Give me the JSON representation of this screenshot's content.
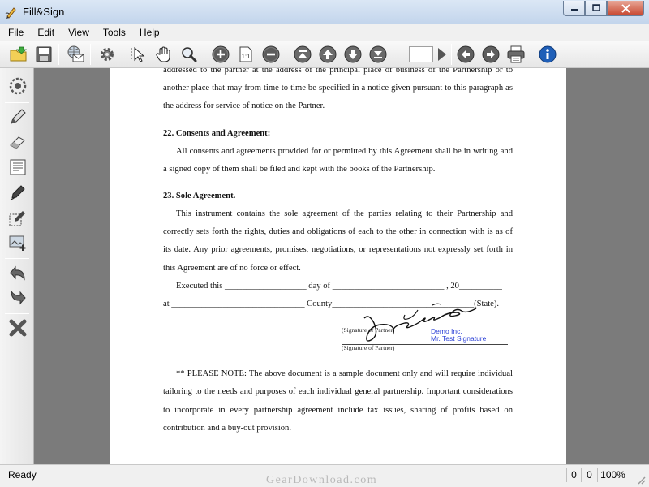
{
  "window": {
    "title": "Fill&Sign"
  },
  "menu": [
    {
      "key": "F",
      "rest": "ile"
    },
    {
      "key": "E",
      "rest": "dit"
    },
    {
      "key": "V",
      "rest": "iew"
    },
    {
      "key": "T",
      "rest": "ools"
    },
    {
      "key": "H",
      "rest": "elp"
    }
  ],
  "toolbar": {
    "page_number": ""
  },
  "document": {
    "p_intro": "addressed to the partner at the address of the principal place of business of the Partnership or to another place that may from time to time be specified in a notice given pursuant to this paragraph as the address for service of notice on the Partner.",
    "h22": "22. Consents and Agreement:",
    "p22": "All consents and agreements provided for or permitted by this Agreement shall be in writing and a signed copy of them shall be filed and kept with the books of the Partnership.",
    "h23": "23. Sole Agreement.",
    "p23": "This instrument contains the sole agreement of the parties relating to their Partnership and correctly sets forth the rights, duties and obligations of each to the other in connection with is as of its date. Any prior agreements, promises, negotiations, or representations not expressly set forth in this Agreement are of no force or effect.",
    "executed_line": "Executed this ___________________ day of __________________________ , 20__________",
    "county_line": "at _______________________________ County_________________________________(State).",
    "sig_label_1": "(Signature of Partner)",
    "sig_label_2": "(Signature of Partner)",
    "demo_line_1": "Demo Inc.",
    "demo_line_2": "Mr. Test Signature",
    "note": "** PLEASE NOTE:  The above document is a sample document only and will require individual tailoring to the needs and purposes of each individual general partnership. Important considerations to incorporate in every partnership agreement include tax issues, sharing of profits based on contribution and a buy-out provision."
  },
  "status": {
    "text": "Ready",
    "x": "0",
    "y": "0",
    "zoom": "100%"
  },
  "watermark": "GearDownload.com"
}
